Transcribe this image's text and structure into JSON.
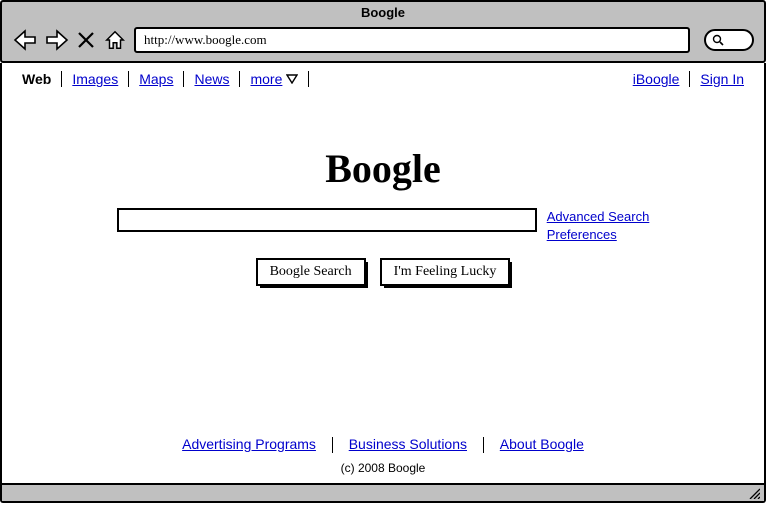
{
  "window": {
    "title": "Boogle",
    "url": "http://www.boogle.com"
  },
  "nav": {
    "tabs": [
      {
        "label": "Web",
        "active": true
      },
      {
        "label": "Images"
      },
      {
        "label": "Maps"
      },
      {
        "label": "News"
      },
      {
        "label": "more"
      }
    ],
    "right": [
      {
        "label": "iBoogle"
      },
      {
        "label": "Sign In"
      }
    ]
  },
  "main": {
    "logo": "Boogle",
    "side_links": {
      "advanced": "Advanced Search",
      "prefs": "Preferences"
    },
    "buttons": {
      "search": "Boogle Search",
      "lucky": "I'm Feeling Lucky"
    }
  },
  "footer": {
    "links": {
      "ads": "Advertising Programs",
      "biz": "Business Solutions",
      "about": "About Boogle"
    },
    "copyright": "(c) 2008 Boogle"
  }
}
